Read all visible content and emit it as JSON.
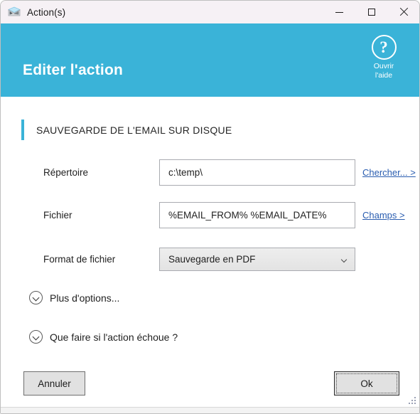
{
  "window": {
    "title": "Action(s)",
    "app_icon": "mail-envelope-icon",
    "controls": {
      "minimize": "minimize-icon",
      "maximize": "maximize-icon",
      "close": "close-icon"
    }
  },
  "header": {
    "title": "Editer l'action",
    "accent_color": "#3ab3d8",
    "help": {
      "icon": "question-mark-icon",
      "line1": "Ouvrir",
      "line2": "l'aide"
    }
  },
  "section": {
    "title": "SAUVEGARDE DE L'EMAIL SUR DISQUE"
  },
  "fields": {
    "directory": {
      "label": "Répertoire",
      "value": "c:\\temp\\",
      "placeholder": "",
      "link": "Chercher... >"
    },
    "file": {
      "label": "Fichier",
      "value": "%EMAIL_FROM% %EMAIL_DATE%",
      "placeholder": "",
      "link": "Champs >"
    },
    "format": {
      "label": "Format de fichier",
      "value": "Sauvegarde en PDF",
      "arrow_icon": "chevron-down-icon"
    }
  },
  "expanders": [
    {
      "label": "Plus d'options...",
      "icon": "chevron-down-circle-icon"
    },
    {
      "label": "Que faire si l'action échoue ?",
      "icon": "chevron-down-circle-icon"
    }
  ],
  "buttons": {
    "cancel": "Annuler",
    "ok": "Ok"
  }
}
